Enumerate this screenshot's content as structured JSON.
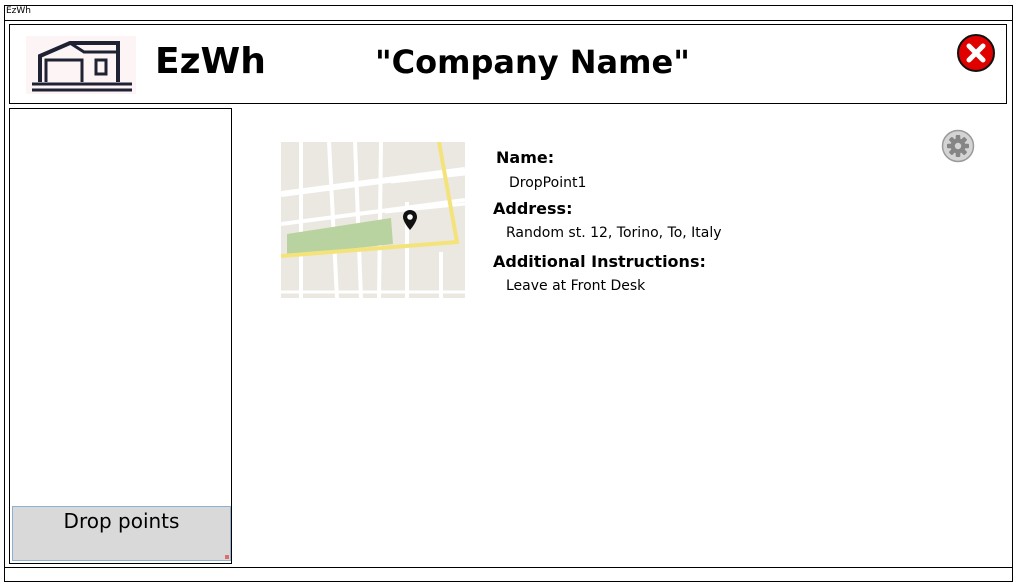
{
  "window": {
    "title": "EzWh"
  },
  "header": {
    "logo_icon": "warehouse-icon",
    "app_name": "EzWh",
    "company_name": "\"Company Name\"",
    "close_icon": "close-icon",
    "close_color": "#e00000"
  },
  "sidebar": {
    "button_label": "Drop points"
  },
  "detail": {
    "map_icon": "map-icon",
    "pin_icon": "map-pin-icon",
    "settings_icon": "gear-icon",
    "fields": [
      {
        "label": "Name:",
        "value": "DropPoint1"
      },
      {
        "label": "Address:",
        "value": "Random st. 12, Torino, To, Italy"
      },
      {
        "label": "Additional Instructions:",
        "value": "Leave at Front Desk"
      }
    ]
  }
}
